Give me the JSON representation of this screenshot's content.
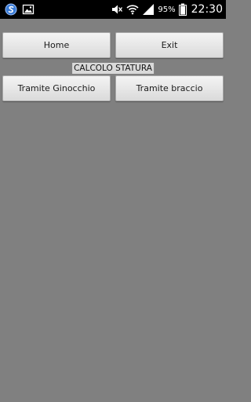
{
  "status_bar": {
    "left_icons": [
      "s-app-icon",
      "gallery-icon"
    ],
    "right_icons": [
      "mute-icon",
      "wifi-icon",
      "signal-icon",
      "battery-icon"
    ],
    "battery_percent": "95%",
    "time": "22:30"
  },
  "toolbar": {
    "home_label": "Home",
    "exit_label": "Exit"
  },
  "main": {
    "title": "CALCOLO STATURA",
    "knee_label": "Tramite Ginocchio",
    "arm_label": "Tramite braccio"
  },
  "colors": {
    "background": "#808080",
    "status_bar": "#000000",
    "button_face": "#e6e6e6",
    "title_bg": "#d9d9d9"
  }
}
